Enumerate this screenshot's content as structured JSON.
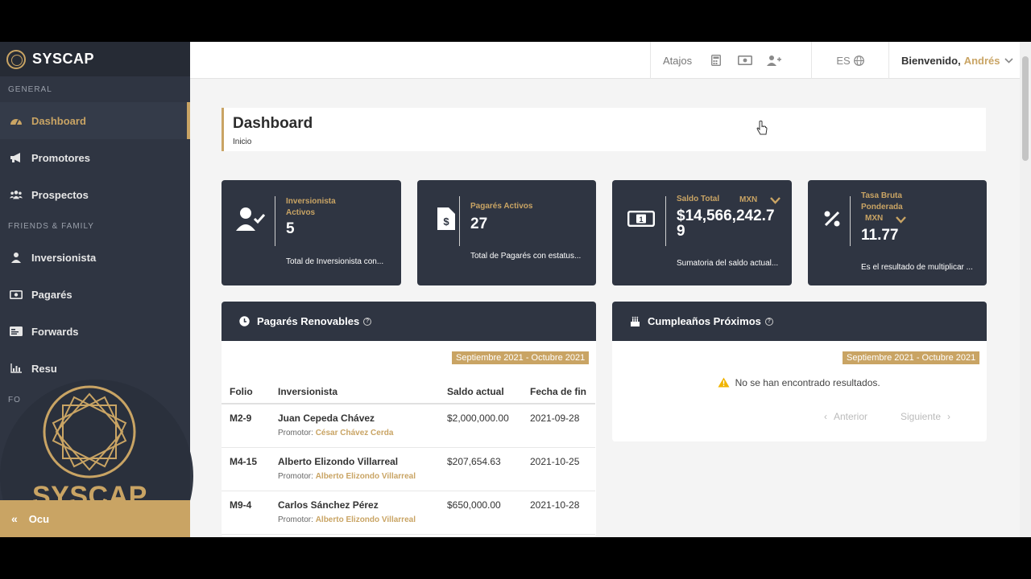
{
  "brand": {
    "name": "SYSCAP"
  },
  "sidebar": {
    "sections": [
      "GENERAL",
      "FRIENDS & FAMILY",
      "FO"
    ],
    "items": [
      {
        "label": "Dashboard"
      },
      {
        "label": "Promotores"
      },
      {
        "label": "Prospectos"
      },
      {
        "label": "Inversionista"
      },
      {
        "label": "Pagarés"
      },
      {
        "label": "Forwards"
      },
      {
        "label": "Resu"
      }
    ],
    "collapse_label": "Ocu"
  },
  "watermark": {
    "text": "SYSCAP"
  },
  "topbar": {
    "shortcuts_label": "Atajos",
    "language": "ES",
    "welcome": "Bienvenido,",
    "user_name": "Andrés"
  },
  "page": {
    "title": "Dashboard",
    "breadcrumb": "Inicio"
  },
  "cards": [
    {
      "title_line1": "Inversionista",
      "title_line2": "Activos",
      "value": "5",
      "description": "Total de Inversionista con..."
    },
    {
      "title_line1": "Pagarés Activos",
      "value": "27",
      "description": "Total de Pagarés con estatus..."
    },
    {
      "title_line1": "Saldo Total",
      "currency": "MXN",
      "value_line1": "$14,566,242.7",
      "value_line2": "9",
      "description": "Sumatoria del saldo actual..."
    },
    {
      "title_line1": "Tasa Bruta",
      "title_line2": "Ponderada",
      "currency": "MXN",
      "value": "11.77",
      "description": "Es el resultado de multiplicar ..."
    }
  ],
  "renewables": {
    "title": "Pagarés Renovables",
    "period": "Septiembre 2021 - Octubre 2021",
    "columns": [
      "Folio",
      "Inversionista",
      "Saldo actual",
      "Fecha de fin"
    ],
    "promoter_label": "Promotor:",
    "rows": [
      {
        "folio": "M2-9",
        "investor": "Juan Cepeda Chávez",
        "promoter": "César Chávez Cerda",
        "balance": "$2,000,000.00",
        "end_date": "2021-09-28"
      },
      {
        "folio": "M4-15",
        "investor": "Alberto Elizondo Villarreal",
        "promoter": "Alberto Elizondo Villarreal",
        "balance": "$207,654.63",
        "end_date": "2021-10-25"
      },
      {
        "folio": "M9-4",
        "investor": "Carlos Sánchez Pérez",
        "promoter": "Alberto Elizondo Villarreal",
        "balance": "$650,000.00",
        "end_date": "2021-10-28"
      }
    ]
  },
  "birthdays": {
    "title": "Cumpleaños Próximos",
    "period": "Septiembre 2021 - Octubre 2021",
    "empty_message": "No se han encontrado resultados.",
    "prev_label": "Anterior",
    "next_label": "Siguiente"
  },
  "colors": {
    "accent": "#c9a464",
    "sidebar": "#2f3542",
    "card": "#2f3542"
  }
}
